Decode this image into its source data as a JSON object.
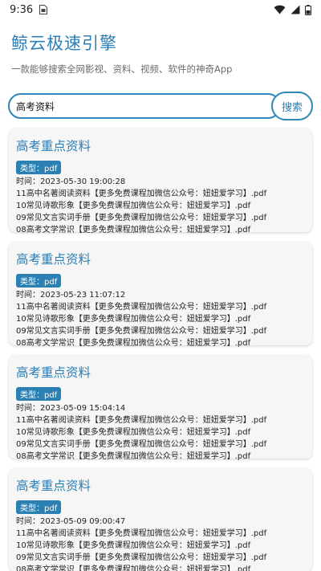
{
  "status_bar": {
    "time": "9:36",
    "icons": [
      "sim-card-icon",
      "wifi-icon",
      "signal-icon",
      "battery-icon"
    ]
  },
  "header": {
    "title": "鲸云极速引擎",
    "subtitle": "一款能够搜索全网影视、资料、视频、软件的神奇App"
  },
  "search": {
    "value": "高考资料",
    "button_label": "搜索"
  },
  "colors": {
    "accent": "#2b7fb6",
    "badge_bg": "#2a7fb3",
    "card_bg": "#f6f6f6"
  },
  "results": [
    {
      "title": "高考重点资料",
      "type": "类型：pdf",
      "time": "时间：2023-05-30 19:00:28",
      "files": [
        "11高中名著阅读资料【更多免费课程加微信公众号：妞妞爱学习】.pdf",
        "10常见诗歌形象【更多免费课程加微信公众号：妞妞爱学习】.pdf",
        "09常见文言实词手册【更多免费课程加微信公众号：妞妞爱学习】.pdf",
        "08高考文学常识【更多免费课程加微信公众号：妞妞爱学习】.pdf"
      ]
    },
    {
      "title": "高考重点资料",
      "type": "类型：pdf",
      "time": "时间：2023-05-23 11:07:12",
      "files": [
        "11高中名著阅读资料【更多免费课程加微信公众号：妞妞爱学习】.pdf",
        "10常见诗歌形象【更多免费课程加微信公众号：妞妞爱学习】.pdf",
        "09常见文言实词手册【更多免费课程加微信公众号：妞妞爱学习】.pdf",
        "08高考文学常识【更多免费课程加微信公众号：妞妞爱学习】.pdf"
      ]
    },
    {
      "title": "高考重点资料",
      "type": "类型：pdf",
      "time": "时间：2023-05-09 15:04:14",
      "files": [
        "11高中名著阅读资料【更多免费课程加微信公众号：妞妞爱学习】.pdf",
        "10常见诗歌形象【更多免费课程加微信公众号：妞妞爱学习】.pdf",
        "09常见文言实词手册【更多免费课程加微信公众号：妞妞爱学习】.pdf",
        "08高考文学常识【更多免费课程加微信公众号：妞妞爱学习】.pdf"
      ]
    },
    {
      "title": "高考重点资料",
      "type": "类型：pdf",
      "time": "时间：2023-05-09 09:00:47",
      "files": [
        "11高中名著阅读资料【更多免费课程加微信公众号：妞妞爱学习】.pdf",
        "10常见诗歌形象【更多免费课程加微信公众号：妞妞爱学习】.pdf",
        "09常见文言实词手册【更多免费课程加微信公众号：妞妞爱学习】.pdf",
        "08高考文学常识【更多免费课程加微信公众号：妞妞爱学习】.pdf"
      ]
    }
  ]
}
